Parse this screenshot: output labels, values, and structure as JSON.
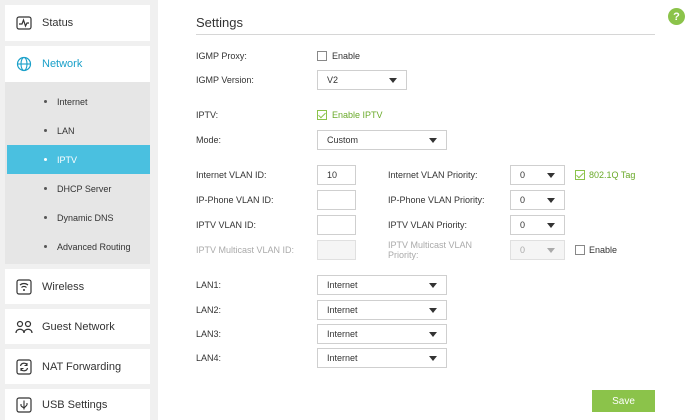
{
  "sidebar": {
    "items": [
      {
        "label": "Status",
        "icon": "status-icon"
      },
      {
        "label": "Network",
        "icon": "globe-icon",
        "active": true
      },
      {
        "label": "Wireless",
        "icon": "wireless-icon"
      },
      {
        "label": "Guest Network",
        "icon": "guest-network-icon"
      },
      {
        "label": "NAT Forwarding",
        "icon": "nat-forwarding-icon"
      },
      {
        "label": "USB Settings",
        "icon": "usb-icon"
      }
    ],
    "submenu": [
      {
        "label": "Internet"
      },
      {
        "label": "LAN"
      },
      {
        "label": "IPTV",
        "active": true
      },
      {
        "label": "DHCP Server"
      },
      {
        "label": "Dynamic DNS"
      },
      {
        "label": "Advanced Routing"
      }
    ]
  },
  "main": {
    "title": "Settings",
    "help": "?",
    "igmp_proxy": {
      "label": "IGMP Proxy:",
      "option": "Enable",
      "checked": false
    },
    "igmp_version": {
      "label": "IGMP Version:",
      "value": "V2"
    },
    "iptv": {
      "label": "IPTV:",
      "option": "Enable IPTV",
      "checked": true
    },
    "mode": {
      "label": "Mode:",
      "value": "Custom"
    },
    "internet_vlan_id": {
      "label": "Internet VLAN ID:",
      "value": "10"
    },
    "internet_vlan_priority": {
      "label": "Internet VLAN Priority:",
      "value": "0"
    },
    "tag_8021q": {
      "label": "802.1Q Tag",
      "checked": true
    },
    "ip_phone_vlan_id": {
      "label": "IP-Phone VLAN ID:",
      "value": ""
    },
    "ip_phone_vlan_priority": {
      "label": "IP-Phone VLAN Priority:",
      "value": "0"
    },
    "iptv_vlan_id": {
      "label": "IPTV VLAN ID:",
      "value": ""
    },
    "iptv_vlan_priority": {
      "label": "IPTV VLAN Priority:",
      "value": "0"
    },
    "iptv_multicast_vlan_id": {
      "label": "IPTV Multicast VLAN ID:",
      "value": ""
    },
    "iptv_multicast_vlan_priority": {
      "label": "IPTV Multicast VLAN Priority:",
      "value": "0"
    },
    "multicast_enable": {
      "label": "Enable",
      "checked": false
    },
    "lan1": {
      "label": "LAN1:",
      "value": "Internet"
    },
    "lan2": {
      "label": "LAN2:",
      "value": "Internet"
    },
    "lan3": {
      "label": "LAN3:",
      "value": "Internet"
    },
    "lan4": {
      "label": "LAN4:",
      "value": "Internet"
    },
    "save_label": "Save"
  },
  "colors": {
    "accent": "#4ac0e0",
    "active_text": "#1aa0c9",
    "green": "#8bc34a"
  }
}
